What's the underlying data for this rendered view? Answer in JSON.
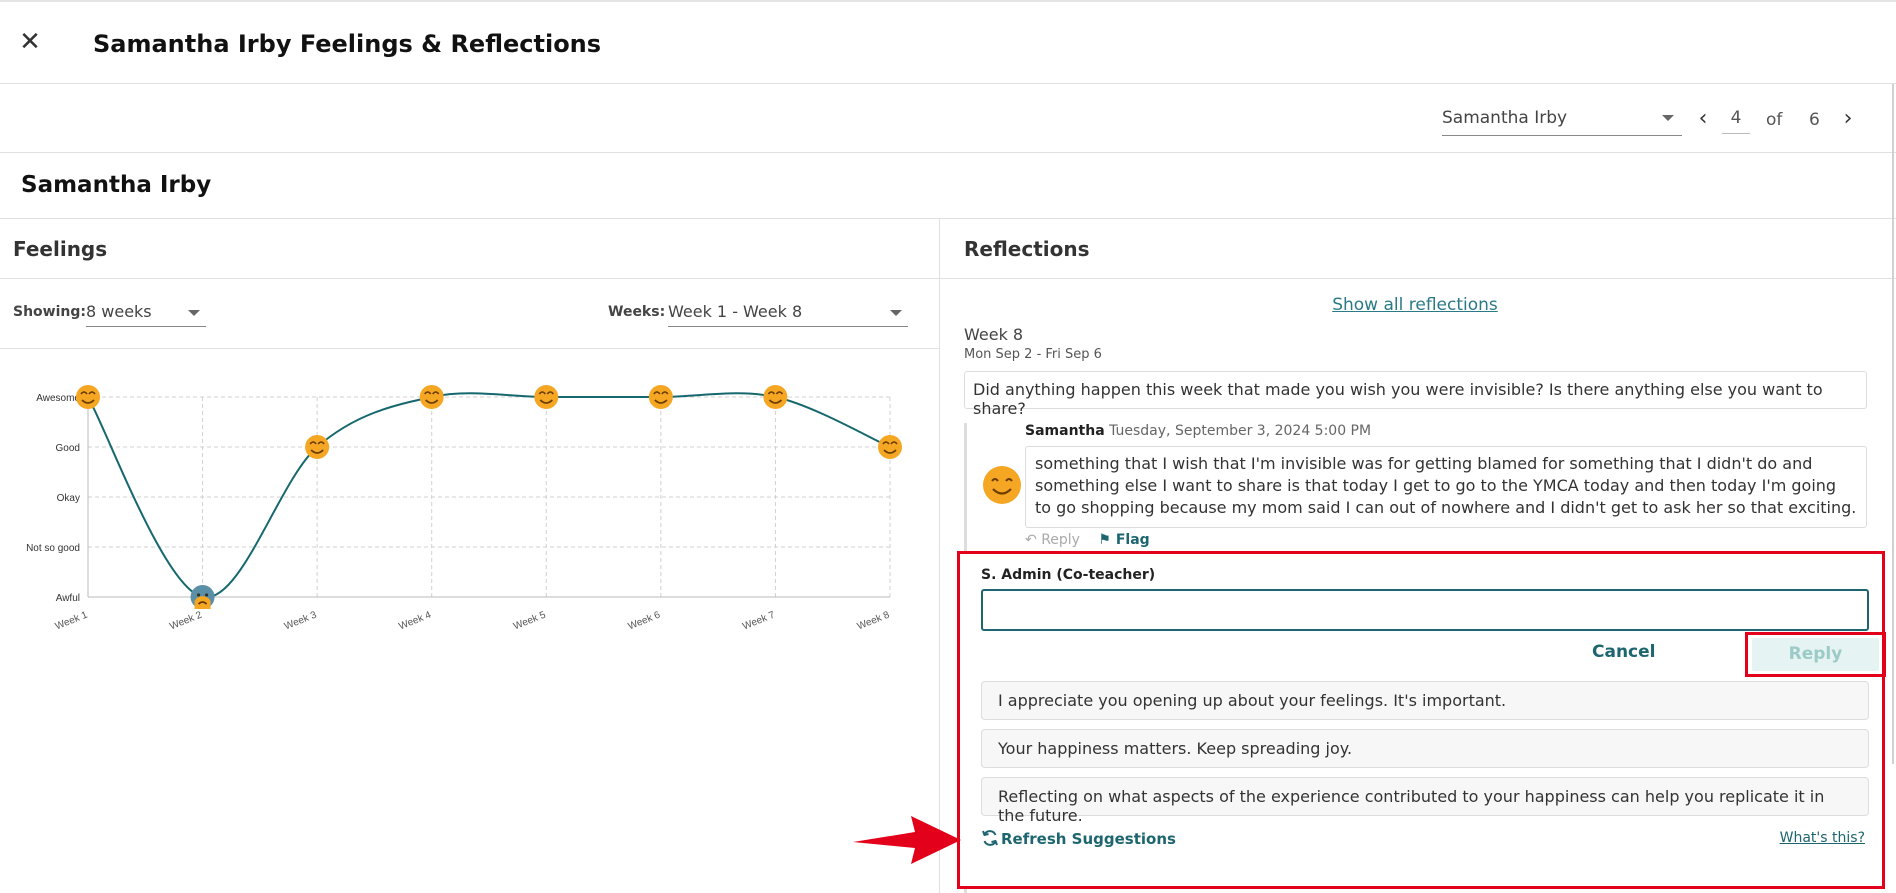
{
  "header": {
    "close_icon": "close-icon",
    "title": "Samantha Irby Feelings & Reflections"
  },
  "pager": {
    "student_select_value": "Samantha Irby",
    "current_page": "4",
    "of_label": "of",
    "total_pages": "6"
  },
  "student": {
    "name": "Samantha Irby"
  },
  "feelings": {
    "heading": "Feelings",
    "showing_label": "Showing:",
    "showing_value": "8 weeks",
    "weeks_label": "Weeks:",
    "weeks_value": "Week 1 - Week 8"
  },
  "chart_data": {
    "type": "line",
    "categories": [
      "Week 1",
      "Week 2",
      "Week 3",
      "Week 4",
      "Week 5",
      "Week 6",
      "Week 7",
      "Week 8"
    ],
    "y_levels": [
      "Awful",
      "Not so good",
      "Okay",
      "Good",
      "Awesome"
    ],
    "series": [
      {
        "values": [
          "Awesome",
          "Awful",
          "Good",
          "Awesome",
          "Awesome",
          "Awesome",
          "Awesome",
          "Good"
        ]
      }
    ],
    "line_color": "#16686f",
    "marker_icons": [
      "happy-face-icon",
      "sad-face-icon",
      "happy-face-icon",
      "happy-face-icon",
      "happy-face-icon",
      "happy-face-icon",
      "happy-face-icon",
      "happy-face-icon"
    ],
    "grid": true
  },
  "reflections": {
    "heading": "Reflections",
    "show_all": "Show all reflections",
    "week_label": "Week 8",
    "week_range": "Mon Sep 2 - Fri Sep 6",
    "prompt": "Did anything happen this week that made you wish you were invisible? Is there anything else you want to share?",
    "entry": {
      "author": "Samantha",
      "timestamp": "Tuesday, September 3, 2024 5:00 PM",
      "text": "something that I wish that I'm invisible was for getting blamed for something that I didn't do and something else I want to share is that today I get to go to the YMCA today and then today I'm going to go shopping because my mom said I can out of nowhere and I didn't get to ask her so that exciting.",
      "reply_label": "Reply",
      "flag_label": "Flag"
    },
    "reply_form": {
      "author": "S. Admin (Co-teacher)",
      "input_value": "",
      "cancel_label": "Cancel",
      "reply_label": "Reply",
      "suggestions": [
        "I appreciate you opening up about your feelings. It's important.",
        "Your happiness matters. Keep spreading joy.",
        "Reflecting on what aspects of the experience contributed to your happiness can help you replicate it in the future."
      ],
      "refresh_label": "Refresh Suggestions",
      "whats_this_label": "What's this?"
    }
  },
  "colors": {
    "accent": "#1d6670",
    "highlight_red": "#e3001b",
    "emoji_yellow": "#f5a623"
  }
}
